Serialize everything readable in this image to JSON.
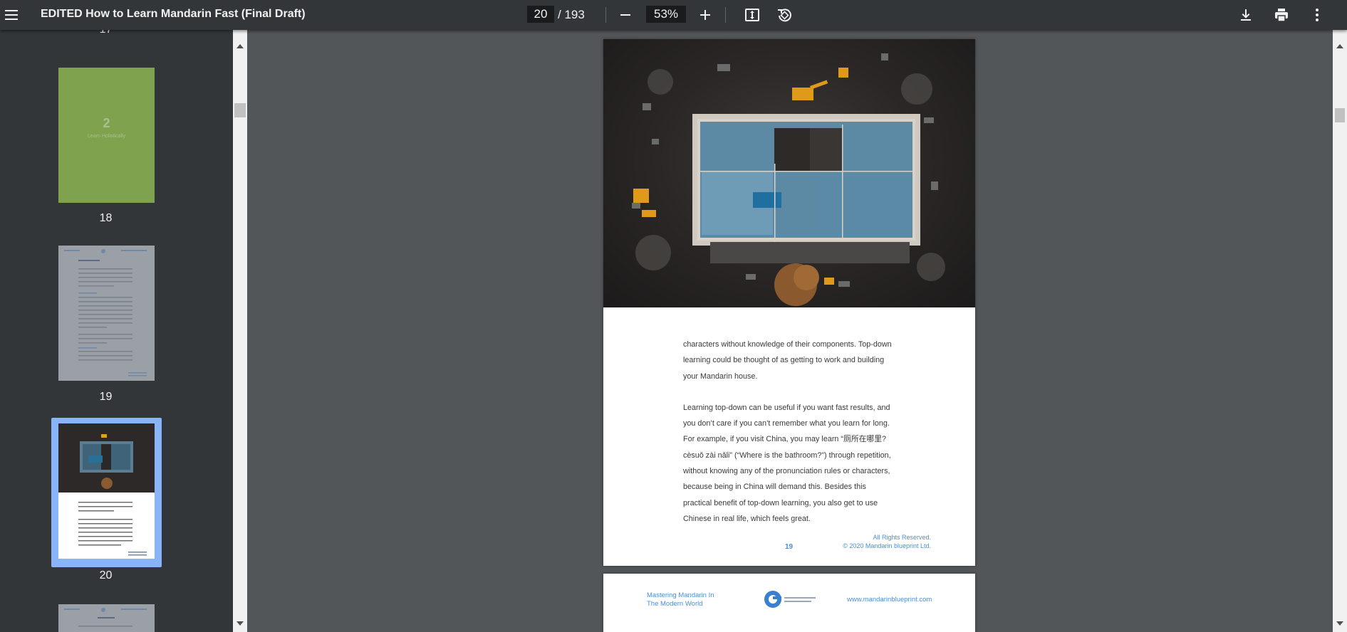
{
  "toolbar": {
    "title": "EDITED How to Learn Mandarin Fast (Final Draft)",
    "current_page": "20",
    "total_pages": "/ 193",
    "zoom": "53%"
  },
  "sidebar": {
    "partial_label_top": "17",
    "thumbnails": [
      {
        "label": "18",
        "chapter_number": "2",
        "chapter_title": "Learn Holistically",
        "color": "#7ea24e"
      },
      {
        "label": "19"
      },
      {
        "label": "20",
        "selected": true
      }
    ]
  },
  "document": {
    "paragraphs": [
      "characters without knowledge of their components. Top-down learning could be thought of as getting to work and building your Mandarin house.",
      "Learning top-down can be useful if you want fast results, and you don’t care if you can’t remember what you learn for long. For example, if you visit China, you may learn “厕所在哪里? cèsuǒ zài nǎli” (“Where is the bathroom?”) through repetition, without knowing any of the pronunciation rules or characters, because being in China will demand this. Besides this practical benefit of top-down learning, you also get to use Chinese in real life, which feels great."
    ],
    "page_number": "19",
    "rights_line1": "All Rights Reserved.",
    "rights_line2": "© 2020 Mandarin blueprint Ltd.",
    "next_header_left": "Mastering Mandarin In The Modern World",
    "next_header_right": "www.mandarinblueprint.com",
    "logo_text": "MANDARIN BLUEPRINT",
    "accent_color": "#4a8fd6"
  }
}
